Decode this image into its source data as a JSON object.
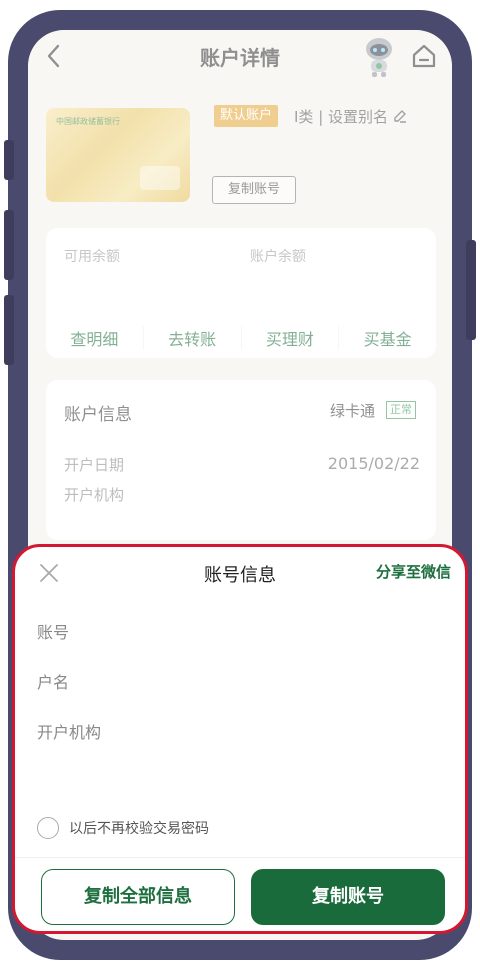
{
  "nav": {
    "title": "账户详情"
  },
  "card": {
    "bank_name": "中国邮政储蓄银行",
    "default_tag": "默认账户",
    "type_and_alias": "I类 | 设置别名",
    "copy_button": "复制账号"
  },
  "balance": {
    "available_label": "可用余额",
    "account_label": "账户余额",
    "actions": [
      "查明细",
      "去转账",
      "买理财",
      "买基金"
    ]
  },
  "account_info": {
    "title": "账户信息",
    "product": "绿卡通",
    "status": "正常",
    "open_date_label": "开户日期",
    "open_date_value": "2015/02/22",
    "institution_label": "开户机构"
  },
  "sheet": {
    "title": "账号信息",
    "share_label": "分享至微信",
    "fields": [
      "账号",
      "户名",
      "开户机构"
    ],
    "checkbox_label": "以后不再校验交易密码",
    "copy_all_label": "复制全部信息",
    "copy_account_label": "复制账号"
  },
  "colors": {
    "brand_green": "#1a6b3c",
    "highlight_border": "#d31832",
    "default_tag": "#e3a633"
  }
}
